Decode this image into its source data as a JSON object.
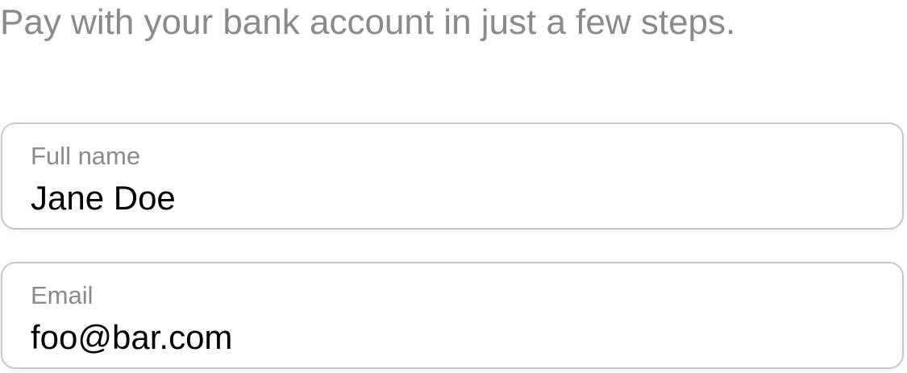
{
  "header": {
    "subtitle": "Pay with your bank account in just a few steps."
  },
  "form": {
    "full_name": {
      "label": "Full name",
      "value": "Jane Doe"
    },
    "email": {
      "label": "Email",
      "value": "foo@bar.com"
    }
  },
  "colors": {
    "secondary_text": "#8a8a8e",
    "field_border": "#c8c8cc",
    "primary_text": "#000000",
    "background": "#ffffff"
  }
}
